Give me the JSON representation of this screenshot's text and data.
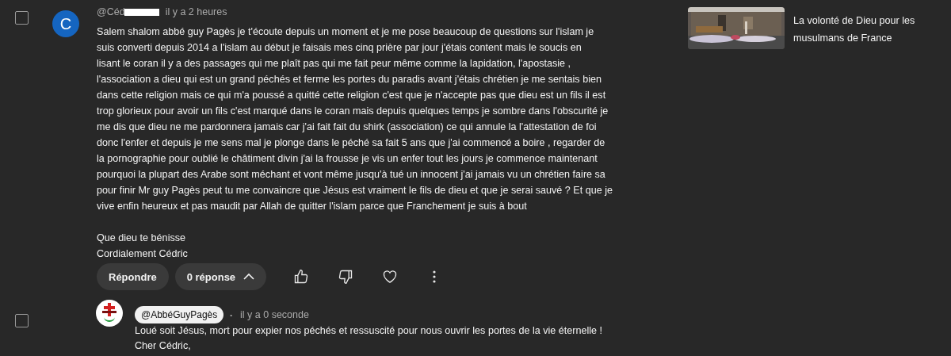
{
  "comments": [
    {
      "kind": "user",
      "checked": false,
      "avatar_letter": "C",
      "author": "@Céd",
      "author_redacted": true,
      "time": "il y a 2 heures",
      "body_lines": [
        "Salem shalom abbé guy Pagès je t'écoute depuis un moment et je me pose beaucoup de questions sur l'islam je",
        "suis converti depuis 2014 a l'islam au début je faisais mes cinq prière par jour j'étais content mais le soucis en",
        "lisant le coran il y a des passages qui me plaît pas qui me fait peur même comme la lapidation, l'apostasie ,",
        "l'association a dieu qui est un grand péchés et ferme les portes du paradis avant j'étais chrétien je me sentais bien",
        "dans cette religion mais ce qui m'a poussé a quitté cette religion c'est que je n'accepte pas que dieu est un fils il est",
        "trop glorieux pour avoir un fils c'est marqué dans le coran mais depuis quelques temps je sombre dans l'obscurité je",
        "me dis que dieu ne me pardonnera jamais car j'ai fait fait du shirk (association) ce qui annule la l'attestation de foi",
        "donc l'enfer et depuis je me sens mal je plonge dans le péché sa fait 5 ans que j'ai commencé a boire , regarder de",
        "la pornographie pour oublié le châtiment divin j'ai la frousse je vis un enfer tout les jours je commence maintenant",
        "pourquoi la plupart des Arabe sont méchant et vont même jusqu'à tué un innocent j'ai jamais vu un chrétien faire sa",
        "pour finir Mr guy Pagès peut tu me convaincre que Jésus est vraiment le fils de dieu et que je serai sauvé ? Et que je",
        "vive enfin heureux et pas maudit par Allah de quitter l'islam parce que Franchement je suis à bout"
      ],
      "closing_lines": [
        "Que dieu te bénisse",
        "Cordialement Cédric"
      ],
      "reply_button": "Répondre",
      "replies_button": "0 réponse"
    },
    {
      "kind": "channel",
      "checked": false,
      "author": "@AbbéGuyPagès",
      "separator": "•",
      "time": "il y a 0 seconde",
      "body_lines": [
        "Loué soit Jésus, mort pour expier nos péchés et ressuscité pour nous ouvrir les portes de la vie éternelle !",
        "Cher Cédric,"
      ]
    }
  ],
  "related_video": {
    "title": "La volonté de Dieu pour les musulmans de France"
  }
}
